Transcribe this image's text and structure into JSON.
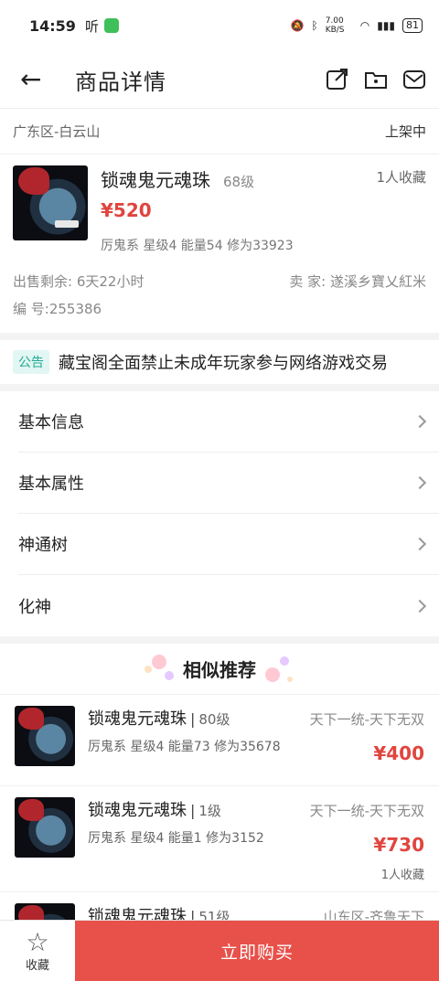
{
  "status_bar": {
    "time": "14:59",
    "app_icon_1": "听",
    "network_speed": "7.00 KB/S",
    "battery": "81"
  },
  "navbar": {
    "back_icon": "←",
    "title": "商品详情"
  },
  "item": {
    "region": "广东区-白云山",
    "status": "上架中",
    "name": "锁魂鬼元魂珠",
    "level": "68级",
    "favorites": "1人收藏",
    "price": "¥520",
    "attributes": "厉鬼系 星级4 能量54 修为33923",
    "remaining_label": "出售剩余:",
    "remaining_value": "6天22小时",
    "seller_label": "卖  家:",
    "seller_value": "遂溪乡寶乂紅米",
    "id_label": "编  号:",
    "id_value": "255386"
  },
  "notice": {
    "tag": "公告",
    "text": "藏宝阁全面禁止未成年玩家参与网络游戏交易"
  },
  "menu": [
    {
      "label": "基本信息"
    },
    {
      "label": "基本属性"
    },
    {
      "label": "神通树"
    },
    {
      "label": "化神"
    }
  ],
  "similar": {
    "title": "相似推荐",
    "items": [
      {
        "name": "锁魂鬼元魂珠",
        "level": "80级",
        "region": "天下一统-天下无双",
        "attributes": "厉鬼系 星级4 能量73 修为35678",
        "price": "¥400",
        "favorites": ""
      },
      {
        "name": "锁魂鬼元魂珠",
        "level": "1级",
        "region": "天下一统-天下无双",
        "attributes": "厉鬼系 星级4 能量1 修为3152",
        "price": "¥730",
        "favorites": "1人收藏"
      },
      {
        "name": "锁魂鬼元魂珠",
        "level": "51级",
        "region": "山东区-齐鲁天下",
        "attributes": "",
        "price": "",
        "favorites": ""
      }
    ]
  },
  "bottom_bar": {
    "favorite_label": "收藏",
    "buy_label": "立即购买"
  },
  "colors": {
    "accent_red": "#e8504a",
    "price_red": "#e0453f",
    "notice_teal": "#23a995"
  }
}
